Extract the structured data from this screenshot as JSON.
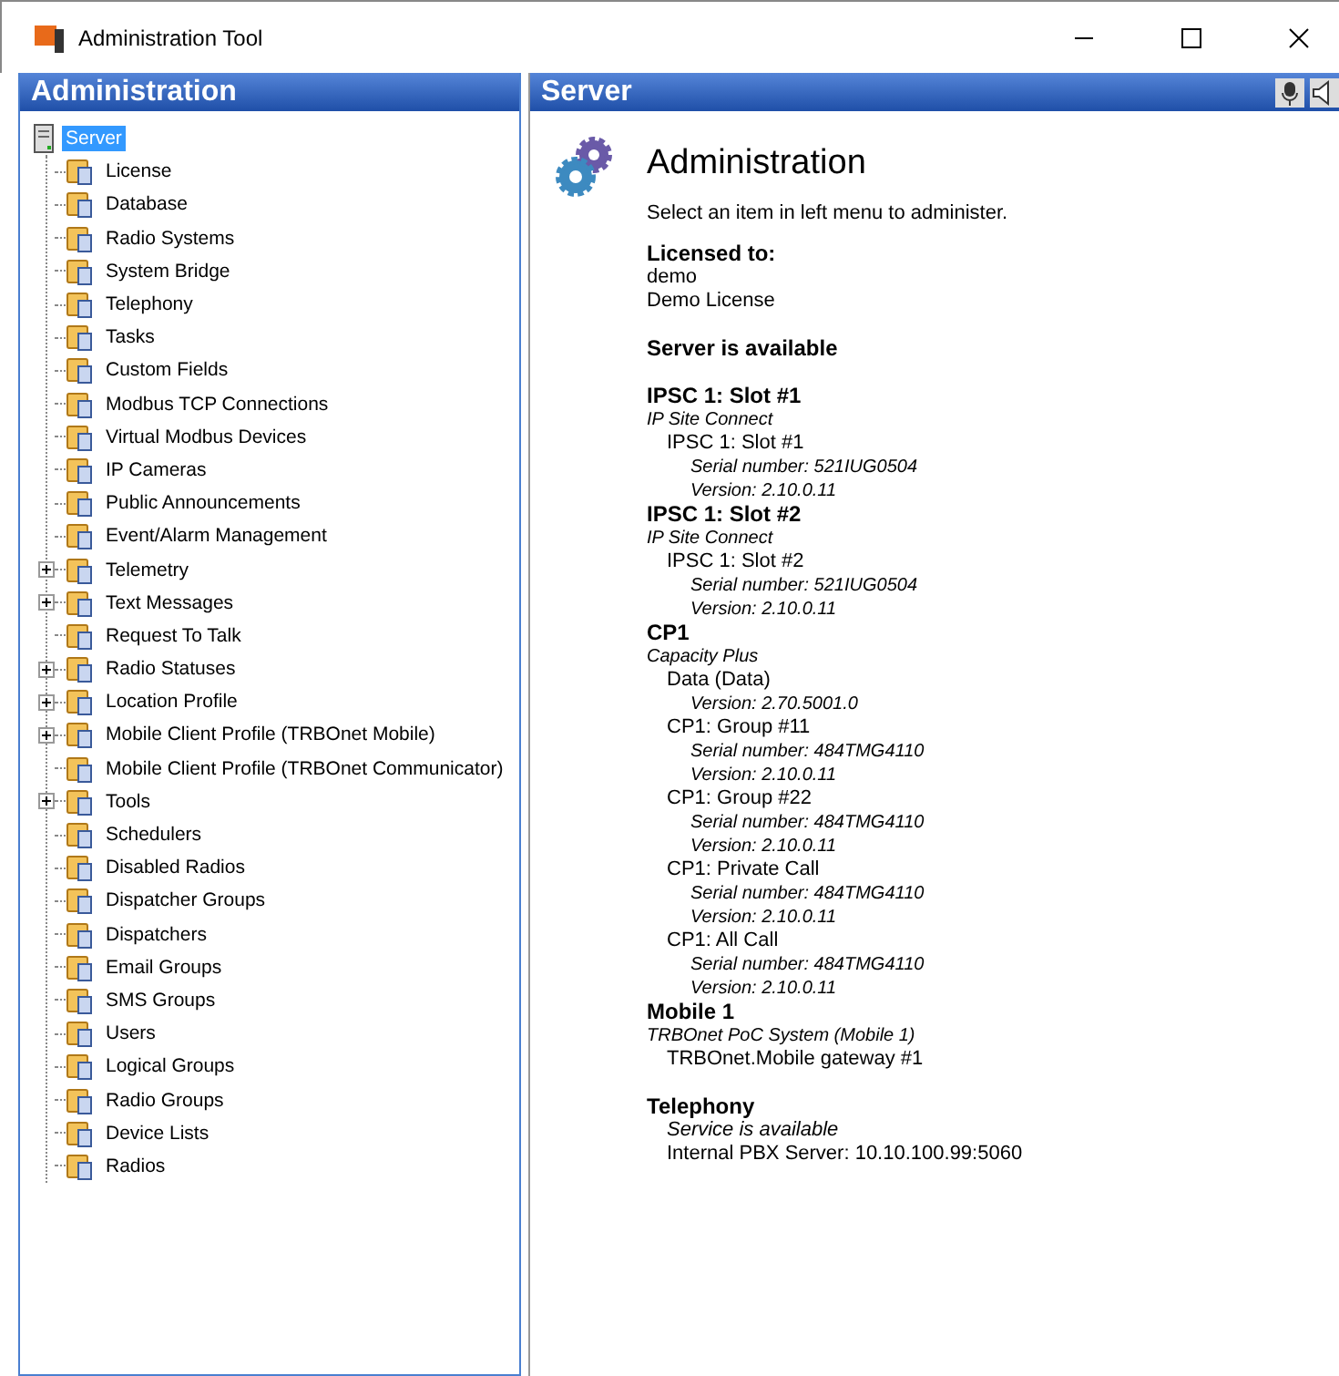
{
  "window": {
    "title": "Administration Tool"
  },
  "left_panel": {
    "title": "Administration"
  },
  "tree": [
    {
      "label": "Server",
      "selected": true,
      "children": [
        {
          "label": "License",
          "selected": false,
          "collapsed": false
        },
        {
          "label": "Database",
          "selected": false,
          "collapsed": false
        },
        {
          "label": "Radio Systems",
          "selected": false,
          "collapsed": false
        },
        {
          "label": "System Bridge",
          "selected": false,
          "collapsed": false
        },
        {
          "label": "Telephony",
          "selected": false,
          "collapsed": false
        },
        {
          "label": "Tasks",
          "selected": false,
          "collapsed": false
        },
        {
          "label": "Custom Fields",
          "selected": false,
          "collapsed": false
        },
        {
          "label": "Modbus TCP Connections",
          "selected": false,
          "collapsed": false
        },
        {
          "label": "Virtual Modbus Devices",
          "selected": false,
          "collapsed": false
        },
        {
          "label": "IP Cameras",
          "selected": false,
          "collapsed": false
        },
        {
          "label": "Public Announcements",
          "selected": false,
          "collapsed": false
        },
        {
          "label": "Event/Alarm Management",
          "selected": false,
          "collapsed": false
        },
        {
          "label": "Telemetry",
          "selected": false,
          "collapsed": true
        },
        {
          "label": "Text Messages",
          "selected": false,
          "collapsed": true
        },
        {
          "label": "Request To Talk",
          "selected": false,
          "collapsed": false
        },
        {
          "label": "Radio Statuses",
          "selected": false,
          "collapsed": true
        },
        {
          "label": "Location Profile",
          "selected": false,
          "collapsed": true
        },
        {
          "label": "Mobile Client Profile (TRBOnet Mobile)",
          "selected": false,
          "collapsed": true
        },
        {
          "label": "Mobile Client Profile (TRBOnet Communicator)",
          "selected": false,
          "collapsed": false
        },
        {
          "label": "Tools",
          "selected": false,
          "collapsed": true
        },
        {
          "label": "Schedulers",
          "selected": false,
          "collapsed": false
        },
        {
          "label": "Disabled Radios",
          "selected": false,
          "collapsed": false
        },
        {
          "label": "Dispatcher Groups",
          "selected": false,
          "collapsed": false
        },
        {
          "label": "Dispatchers",
          "selected": false,
          "collapsed": false
        },
        {
          "label": "Email Groups",
          "selected": false,
          "collapsed": false
        },
        {
          "label": "SMS Groups",
          "selected": false,
          "collapsed": false
        },
        {
          "label": "Users",
          "selected": false,
          "collapsed": false
        },
        {
          "label": "Logical Groups",
          "selected": false,
          "collapsed": false
        },
        {
          "label": "Radio Groups",
          "selected": false,
          "collapsed": false
        },
        {
          "label": "Device Lists",
          "selected": false,
          "collapsed": false
        },
        {
          "label": "Radios",
          "selected": false,
          "collapsed": false
        }
      ]
    }
  ],
  "right_panel": {
    "title": "Server"
  },
  "content": {
    "title": "Administration",
    "lines": [
      {
        "kind": "text",
        "text": "Select an item in left menu to administer."
      },
      {
        "kind": "heading",
        "text": "Licensed to:"
      },
      {
        "kind": "plain",
        "text": "demo"
      },
      {
        "kind": "plain",
        "text": "Demo License"
      },
      {
        "kind": "gap"
      },
      {
        "kind": "heading",
        "text": "Server is available"
      },
      {
        "kind": "gap"
      },
      {
        "kind": "heading",
        "text": "IPSC 1: Slot #1"
      },
      {
        "kind": "note",
        "text": "IP Site Connect"
      },
      {
        "kind": "sub",
        "text": "IPSC 1: Slot #1"
      },
      {
        "kind": "detail",
        "text": "Serial number:  521IUG0504"
      },
      {
        "kind": "detail",
        "text": "Version:  2.10.0.11"
      },
      {
        "kind": "heading",
        "text": "IPSC 1: Slot #2"
      },
      {
        "kind": "note",
        "text": "IP Site Connect"
      },
      {
        "kind": "sub",
        "text": "IPSC 1: Slot #2"
      },
      {
        "kind": "detail",
        "text": "Serial number:  521IUG0504"
      },
      {
        "kind": "detail",
        "text": "Version:  2.10.0.11"
      },
      {
        "kind": "heading",
        "text": "CP1"
      },
      {
        "kind": "note",
        "text": "Capacity Plus"
      },
      {
        "kind": "sub",
        "text": "Data (Data)"
      },
      {
        "kind": "detail",
        "text": "Version:  2.70.5001.0"
      },
      {
        "kind": "sub",
        "text": "CP1: Group #11"
      },
      {
        "kind": "detail",
        "text": "Serial number:  484TMG4110"
      },
      {
        "kind": "detail",
        "text": "Version:  2.10.0.11"
      },
      {
        "kind": "sub",
        "text": "CP1: Group #22"
      },
      {
        "kind": "detail",
        "text": "Serial number:  484TMG4110"
      },
      {
        "kind": "detail",
        "text": "Version:  2.10.0.11"
      },
      {
        "kind": "sub",
        "text": "CP1: Private Call"
      },
      {
        "kind": "detail",
        "text": "Serial number:  484TMG4110"
      },
      {
        "kind": "detail",
        "text": "Version:  2.10.0.11"
      },
      {
        "kind": "sub",
        "text": "CP1: All Call"
      },
      {
        "kind": "detail",
        "text": "Serial number:  484TMG4110"
      },
      {
        "kind": "detail",
        "text": "Version:  2.10.0.11"
      },
      {
        "kind": "heading",
        "text": "Mobile 1"
      },
      {
        "kind": "note",
        "text": "TRBOnet PoC System (Mobile 1)"
      },
      {
        "kind": "sub",
        "text": "TRBOnet.Mobile gateway #1"
      },
      {
        "kind": "gap"
      },
      {
        "kind": "heading",
        "text": "Telephony"
      },
      {
        "kind": "subnote",
        "text": "Service is available"
      },
      {
        "kind": "sub",
        "text": "Internal PBX Server: 10.10.100.99:5060"
      }
    ]
  }
}
